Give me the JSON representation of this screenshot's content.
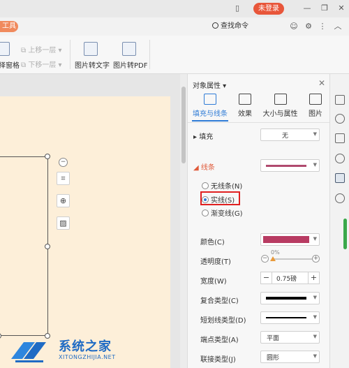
{
  "titlebar": {
    "login_label": "未登录"
  },
  "tabrow": {
    "tool_tab_label": "工具",
    "search_label": "查找命令"
  },
  "ribbon": {
    "selection_pane_label": "择窗格",
    "bring_forward_label": "上移一层",
    "send_backward_label": "下移一层",
    "img_to_text_label": "图片转文字",
    "img_to_pdf_label": "图片转PDF"
  },
  "pane": {
    "title": "对象属性",
    "tabs": [
      {
        "label": "填充与线条"
      },
      {
        "label": "效果"
      },
      {
        "label": "大小与属性"
      },
      {
        "label": "图片"
      }
    ],
    "fill": {
      "label": "填充",
      "value": "无"
    },
    "line": {
      "label": "线条",
      "color": "#b04a6e",
      "options": [
        {
          "label": "无线条(N)",
          "selected": false
        },
        {
          "label": "实线(S)",
          "selected": true
        },
        {
          "label": "渐变线(G)",
          "selected": false
        }
      ]
    },
    "props": {
      "color_label": "颜色(C)",
      "color_value": "#b83b62",
      "transparency_label": "透明度(T)",
      "transparency_value": "0%",
      "width_label": "宽度(W)",
      "width_value": "0.75磅",
      "compound_label": "复合类型(C)",
      "dash_label": "短划线类型(D)",
      "cap_label": "端点类型(A)",
      "cap_value": "平面",
      "join_label": "联接类型(J)",
      "join_value": "圆形"
    }
  },
  "watermark": {
    "cn": "系统之家",
    "en": "XITONGZHIJIA.NET"
  }
}
